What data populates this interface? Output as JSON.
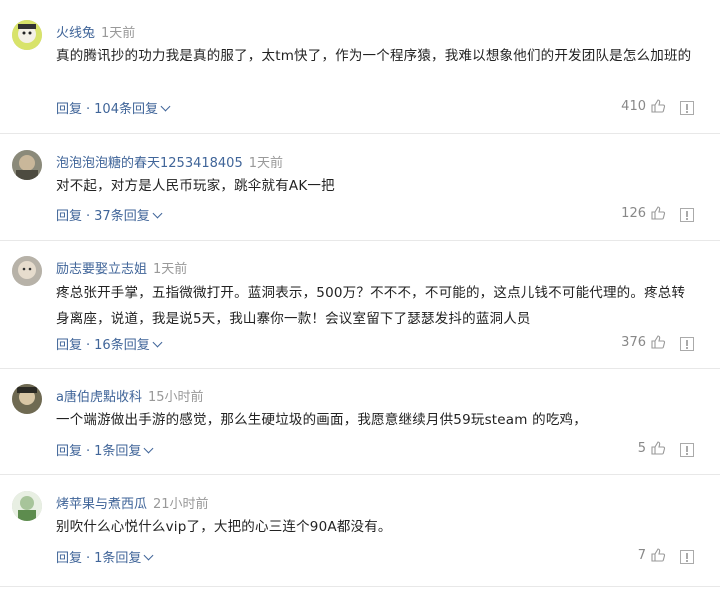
{
  "comments": [
    {
      "user": "火线兔",
      "time": "1天前",
      "text": "真的腾讯抄的功力我是真的服了，太tm快了，作为一个程序猿，我难以想象他们的开发团队是怎么加班的",
      "reply_label": "回复",
      "replies_label": "104条回复",
      "likes": "410",
      "avatar_color": "#d8e36a"
    },
    {
      "user": "泡泡泡泡糖的春天1253418405",
      "time": "1天前",
      "text": "对不起，对方是人民币玩家，跳伞就有AK一把",
      "reply_label": "回复",
      "replies_label": "37条回复",
      "likes": "126",
      "avatar_color": "#8b8a7a"
    },
    {
      "user": "励志要娶立志姐",
      "time": "1天前",
      "text": "疼总张开手掌，五指微微打开。蓝洞表示，500万？不不不，不可能的，这点儿钱不可能代理的。疼总转身离座，说道，我是说5天，我山寨你一款！会议室留下了瑟瑟发抖的蓝洞人员",
      "reply_label": "回复",
      "replies_label": "16条回复",
      "likes": "376",
      "avatar_color": "#b7b2a8"
    },
    {
      "user": "a唐伯虎點收科",
      "time": "15小时前",
      "text": "一个端游做出手游的感觉，那么生硬垃圾的画面，我愿意继续月供59玩steam 的吃鸡，",
      "reply_label": "回复",
      "replies_label": "1条回复",
      "likes": "5",
      "avatar_color": "#6f6a52"
    },
    {
      "user": "烤苹果与煮西瓜",
      "time": "21小时前",
      "text": "别吹什么心悦什么vip了，大把的心三连个90A都没有。",
      "reply_label": "回复",
      "replies_label": "1条回复",
      "likes": "7",
      "avatar_color": "#a7c49a"
    }
  ]
}
